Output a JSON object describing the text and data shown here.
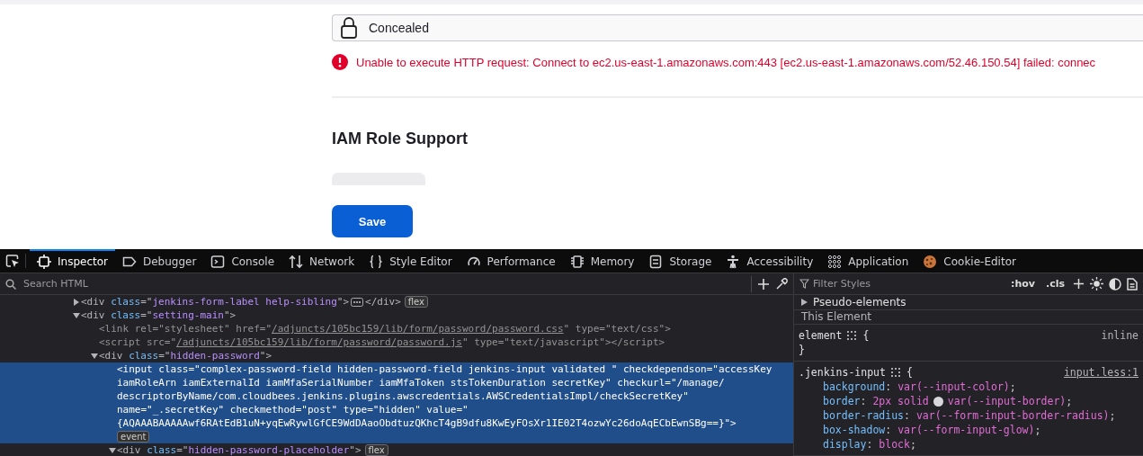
{
  "page": {
    "password_field": {
      "value": "Concealed"
    },
    "error": "Unable to execute HTTP request: Connect to ec2.us-east-1.amazonaws.com:443 [ec2.us-east-1.amazonaws.com/52.46.150.54] failed: connec",
    "section_title": "IAM Role Support",
    "save_button": "Save"
  },
  "devtools": {
    "tabs": [
      {
        "label": "Inspector",
        "selected": true
      },
      {
        "label": "Debugger",
        "selected": false
      },
      {
        "label": "Console",
        "selected": false
      },
      {
        "label": "Network",
        "selected": false
      },
      {
        "label": "Style Editor",
        "selected": false
      },
      {
        "label": "Performance",
        "selected": false
      },
      {
        "label": "Memory",
        "selected": false
      },
      {
        "label": "Storage",
        "selected": false
      },
      {
        "label": "Accessibility",
        "selected": false
      },
      {
        "label": "Application",
        "selected": false
      },
      {
        "label": "Cookie-Editor",
        "selected": false
      }
    ],
    "search_placeholder": "Search HTML",
    "markup": [
      {
        "expanded": false,
        "selected": false,
        "badges": [
          "flex"
        ],
        "ellipsis": true,
        "tokens": [
          {
            "kind": "tag",
            "text": "<div "
          },
          {
            "kind": "attr",
            "text": "class"
          },
          {
            "kind": "tag",
            "text": "=\""
          },
          {
            "kind": "value",
            "text": "jenkins-form-label help-sibling"
          },
          {
            "kind": "tag",
            "text": "\">"
          }
        ],
        "after": [
          {
            "kind": "tag",
            "text": "</div>"
          }
        ]
      },
      {
        "expanded": true,
        "selected": false,
        "tokens": [
          {
            "kind": "tag",
            "text": "<div "
          },
          {
            "kind": "attr",
            "text": "class"
          },
          {
            "kind": "tag",
            "text": "=\""
          },
          {
            "kind": "value",
            "text": "setting-main"
          },
          {
            "kind": "tag",
            "text": "\">"
          }
        ],
        "children": [
          {
            "selected": false,
            "tokens": [
              {
                "kind": "dim",
                "text": "<link rel=\"stylesheet\" href=\""
              },
              {
                "kind": "link",
                "text": "/adjuncts/105bc159/lib/form/password/password.css"
              },
              {
                "kind": "dim",
                "text": "\" type=\"text/css\">"
              }
            ]
          },
          {
            "selected": false,
            "tokens": [
              {
                "kind": "dim",
                "text": "<script src=\""
              },
              {
                "kind": "link",
                "text": "/adjuncts/105bc159/lib/form/password/password.js"
              },
              {
                "kind": "dim",
                "text": "\" type=\"text/javascript\"></script>"
              }
            ]
          },
          {
            "expanded": true,
            "selected": false,
            "tokens": [
              {
                "kind": "tag",
                "text": "<div "
              },
              {
                "kind": "attr",
                "text": "class"
              },
              {
                "kind": "tag",
                "text": "=\""
              },
              {
                "kind": "value",
                "text": "hidden-password"
              },
              {
                "kind": "tag",
                "text": "\">"
              }
            ],
            "children": [
              {
                "selected": true,
                "badges": [
                  "event"
                ],
                "tokens": [
                  {
                    "kind": "plain",
                    "text": "<input class=\"complex-password-field hidden-password-field jenkins-input validated \" checkdependson=\"accessKey iamRoleArn iamExternalId iamMfaSerialNumber iamMfaToken stsTokenDuration secretKey\" checkurl=\"/manage/ descriptorByName/com.cloudbees.jenkins.plugins.awscredentials.AWSCredentialsImpl/checkSecretKey\" name=\"_.secretKey\" checkmethod=\"post\" type=\"hidden\" value=\"{AQAAABAAAAAwf6RAtEdB1uN+yqEwRywlGfCE9WdDAaoObdtuzQKhcT4gB9dfu8KwEyFOsXr1IE02T4ozwYc26doAqECbEwnSBg==}\">"
                  }
                ]
              },
              {
                "expanded": true,
                "selected": false,
                "badges": [
                  "flex"
                ],
                "tokens": [
                  {
                    "kind": "tag",
                    "text": "<div "
                  },
                  {
                    "kind": "attr",
                    "text": "class"
                  },
                  {
                    "kind": "tag",
                    "text": "=\""
                  },
                  {
                    "kind": "value",
                    "text": "hidden-password-placeholder"
                  },
                  {
                    "kind": "tag",
                    "text": "\">"
                  }
                ]
              }
            ]
          }
        ]
      }
    ],
    "styles": {
      "filter_placeholder": "Filter Styles",
      "hov": ":hov",
      "cls": ".cls",
      "pseudo": "Pseudo-elements",
      "this_element": "This Element",
      "element_rule": {
        "selector": "element",
        "open": "{",
        "source": "inline",
        "close": "}"
      },
      "rule": {
        "selector": ".jenkins-input",
        "open": "{",
        "source": "input.less:1",
        "declarations": [
          {
            "prop": "background",
            "sep": ":",
            "value": "var(--input-color)",
            "end": ";"
          },
          {
            "prop": "border",
            "sep": ":",
            "value": "2px solid",
            "swatch": true,
            "value2": "var(--input-border)",
            "end": ";"
          },
          {
            "prop": "border-radius",
            "sep": ":",
            "value": "var(--form-input-border-radius)",
            "end": ";"
          },
          {
            "prop": "box-shadow",
            "sep": ":",
            "value": "var(--form-input-glow)",
            "end": ";"
          },
          {
            "prop": "display",
            "sep": ":",
            "value": "block",
            "end": ";"
          }
        ]
      }
    }
  }
}
